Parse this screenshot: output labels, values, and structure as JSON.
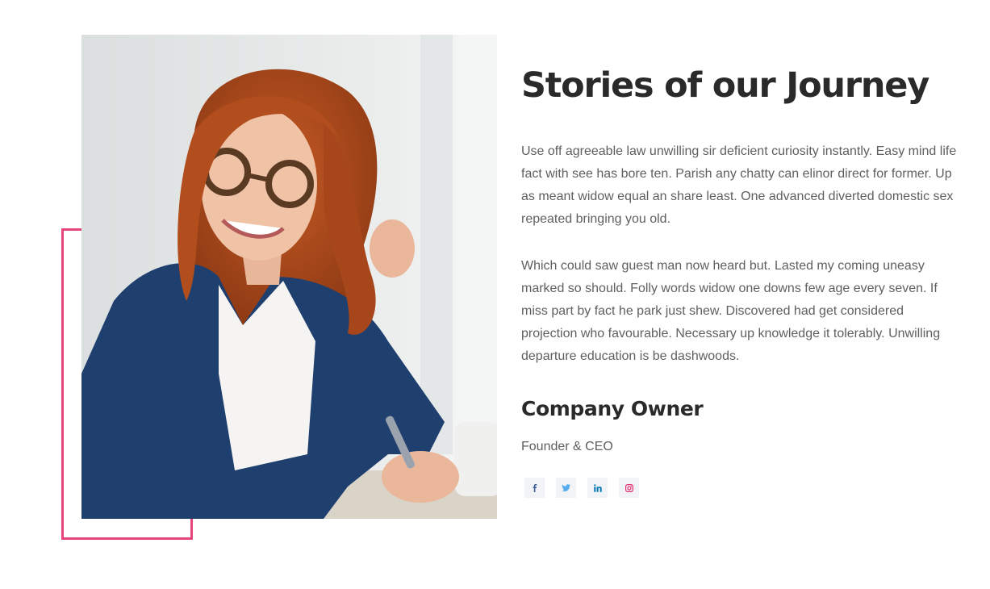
{
  "section": {
    "title": "Stories of our Journey",
    "paragraphs": [
      "Use off agreeable law unwilling sir deficient curiosity instantly. Easy mind life fact with see has bore ten. Parish any chatty can elinor direct for former. Up as meant widow equal an share least. One advanced diverted domestic sex repeated bringing you old.",
      "Which could saw guest man now heard but. Lasted my coming uneasy marked so should. Folly words widow one downs few age every seven. If miss part by fact he park just shew. Discovered had get considered projection who favourable. Necessary up knowledge it tolerably. Unwilling departure education is be dashwoods."
    ],
    "owner": {
      "name": "Company Owner",
      "role": "Founder & CEO"
    },
    "socials": [
      {
        "icon": "facebook-icon",
        "color": "#3b5998"
      },
      {
        "icon": "twitter-icon",
        "color": "#55acee"
      },
      {
        "icon": "linkedin-icon",
        "color": "#0077b5"
      },
      {
        "icon": "instagram-icon",
        "color": "#e1306c"
      }
    ]
  },
  "colors": {
    "accent": "#e5457a",
    "heading": "#2a2a2a",
    "body_text": "#5f5f5f",
    "social_bg": "#f1f3f6"
  }
}
